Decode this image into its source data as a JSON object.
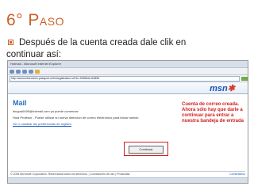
{
  "slide": {
    "title_big": "6° P",
    "title_small": "ASO",
    "line1": "Después de la cuenta creada dale clik en",
    "line2": "continuar así:"
  },
  "screenshot": {
    "titlebar": "Hotmail - Microsoft Internet Explorer",
    "address": "http://accountservices.passport.net/uiregistration.srf?lc=2058&id=64855",
    "msn_logo_a": "msn",
    "msn_logo_b": "✱",
    "mail_title": "Mail",
    "line_a": "lengua0499@hotmail.com ya puede comenzar",
    "line_b": "Hola Profesor - Puede utilizar su nueva dirección de correo electrónico para iniciar sesión",
    "link_c": "Ver o cambiar las preferencias de registro",
    "continue_button": "Continuar",
    "annotation": "Cuenta de correo creada. Ahora sólo hay que darle a continuar para entrar a nuestra bandeja de entrada",
    "footer_left": "© 2006 Microsoft Corporation. Reservados todos los derechos. | Condiciones de uso | Privacidad",
    "footer_right": "Comentarios"
  }
}
